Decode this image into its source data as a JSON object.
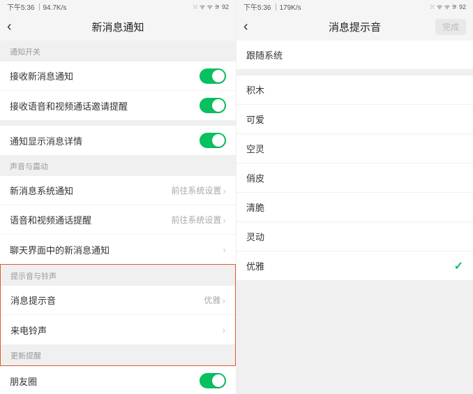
{
  "left": {
    "status": {
      "time": "下午5:36",
      "speed": "94.7K/s",
      "icons": "⁙ ᯤ ᯤ ⚞ 92"
    },
    "nav": {
      "title": "新消息通知"
    },
    "sections": {
      "s1": {
        "header": "通知开关"
      },
      "r1": {
        "label": "接收新消息通知"
      },
      "r2": {
        "label": "接收语音和视频通话邀请提醒"
      },
      "r3": {
        "label": "通知显示消息详情"
      },
      "s2": {
        "header": "声音与震动"
      },
      "r4": {
        "label": "新消息系统通知",
        "value": "前往系统设置"
      },
      "r5": {
        "label": "语音和视频通话提醒",
        "value": "前往系统设置"
      },
      "r6": {
        "label": "聊天界面中的新消息通知"
      },
      "s3": {
        "header": "提示音与铃声"
      },
      "r7": {
        "label": "消息提示音",
        "value": "优雅"
      },
      "r8": {
        "label": "来电铃声"
      },
      "s4": {
        "header": "更新提醒"
      },
      "r9": {
        "label": "朋友圈"
      }
    }
  },
  "right": {
    "status": {
      "time": "下午5:36",
      "speed": "179K/s",
      "icons": "⁙ ᯤ ᯤ ⚞ 92"
    },
    "nav": {
      "title": "消息提示音",
      "done": "完成"
    },
    "sounds": {
      "o0": "跟随系统",
      "o1": "积木",
      "o2": "可爱",
      "o3": "空灵",
      "o4": "俏皮",
      "o5": "清脆",
      "o6": "灵动",
      "o7": "优雅"
    }
  }
}
